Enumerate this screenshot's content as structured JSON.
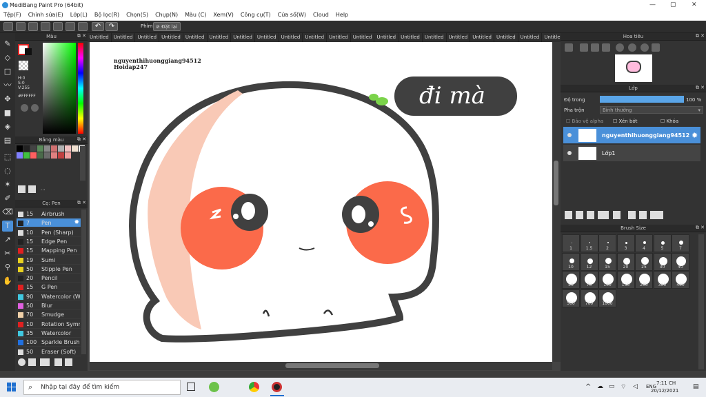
{
  "window": {
    "title": "MediBang Paint Pro (64bit)"
  },
  "menu": [
    "Tệp(F)",
    "Chỉnh sửa(E)",
    "Lớp(L)",
    "Bộ lọc(R)",
    "Chọn(S)",
    "Chụp(N)",
    "Màu (C)",
    "Xem(V)",
    "Công cụ(T)",
    "Cửa sổ(W)",
    "Cloud",
    "Help"
  ],
  "toolbar": {
    "phim_label": "Phím",
    "reset_label": "Đặt lại"
  },
  "color_panel": {
    "title": "Màu",
    "h": "H:0",
    "s": "S:0",
    "v": "V:255",
    "hex": "#FFFFFF"
  },
  "palette_panel": {
    "title": "Bảng màu",
    "more": "..."
  },
  "brush_panel": {
    "title": "Cọ: Pen",
    "items": [
      {
        "size": "15",
        "name": "Airbrush",
        "color": "#dddddd"
      },
      {
        "size": "7",
        "name": "Pen",
        "color": "#222222",
        "selected": true
      },
      {
        "size": "10",
        "name": "Pen (Sharp)",
        "color": "#dddddd"
      },
      {
        "size": "15",
        "name": "Edge Pen",
        "color": "#222222"
      },
      {
        "size": "15",
        "name": "Mapping Pen",
        "color": "#e02020"
      },
      {
        "size": "19",
        "name": "Sumi",
        "color": "#e8d020"
      },
      {
        "size": "50",
        "name": "Stipple Pen",
        "color": "#e8d020"
      },
      {
        "size": "20",
        "name": "Pencil",
        "color": "#222222"
      },
      {
        "size": "15",
        "name": "G Pen",
        "color": "#e02020"
      },
      {
        "size": "90",
        "name": "Watercolor (Wet)",
        "color": "#40c8e0"
      },
      {
        "size": "50",
        "name": "Blur",
        "color": "#e060e0"
      },
      {
        "size": "70",
        "name": "Smudge",
        "color": "#f0d0a8"
      },
      {
        "size": "10",
        "name": "Rotation Symmetry",
        "color": "#e02020"
      },
      {
        "size": "35",
        "name": "Watercolor",
        "color": "#40c8e0"
      },
      {
        "size": "100",
        "name": "Sparkle Brush",
        "color": "#2070e0"
      },
      {
        "size": "50",
        "name": "Eraser (Soft)",
        "color": "#dddddd"
      }
    ]
  },
  "tabs": [
    "Untitled",
    "Untitled",
    "Untitled",
    "Untitled",
    "Untitled",
    "Untitled",
    "Untitled",
    "Untitled",
    "Untitled",
    "Untitled",
    "Untitled",
    "Untitled",
    "Untitled",
    "Untitled",
    "Untitled",
    "Untitled",
    "Untitled",
    "Untitled",
    "Untitled",
    "Untitled",
    "Untitled",
    "Untitled",
    "Untitled",
    "Untitled"
  ],
  "canvas_text": {
    "user": "nguyenthihuonggiang94512",
    "site": "Hoidap247",
    "speech": "đi mà"
  },
  "navigator": {
    "title": "Hoa tiêu"
  },
  "layers": {
    "title": "Lớp",
    "opacity_label": "Độ trong",
    "opacity_value": "100 %",
    "blend_label": "Pha trộn",
    "blend_value": "Bình thường",
    "protect_alpha": "Bảo vệ alpha",
    "clipping": "Xén bớt",
    "lock": "Khóa",
    "items": [
      {
        "name": "nguyenthihuonggiang94512",
        "selected": true
      },
      {
        "name": "Lớp1",
        "selected": false
      }
    ]
  },
  "brush_size": {
    "title": "Brush Size",
    "sizes": [
      "1",
      "1.5",
      "2",
      "3",
      "4",
      "5",
      "7",
      "10",
      "12",
      "15",
      "20",
      "25",
      "30",
      "40",
      "50",
      "70",
      "100",
      "150",
      "200",
      "300",
      "400",
      "500",
      "700",
      "1000"
    ]
  },
  "taskbar": {
    "search_placeholder": "Nhập tại đây để tìm kiếm",
    "lang": "ENG",
    "time": "7:11 CH",
    "date": "20/12/2021"
  }
}
